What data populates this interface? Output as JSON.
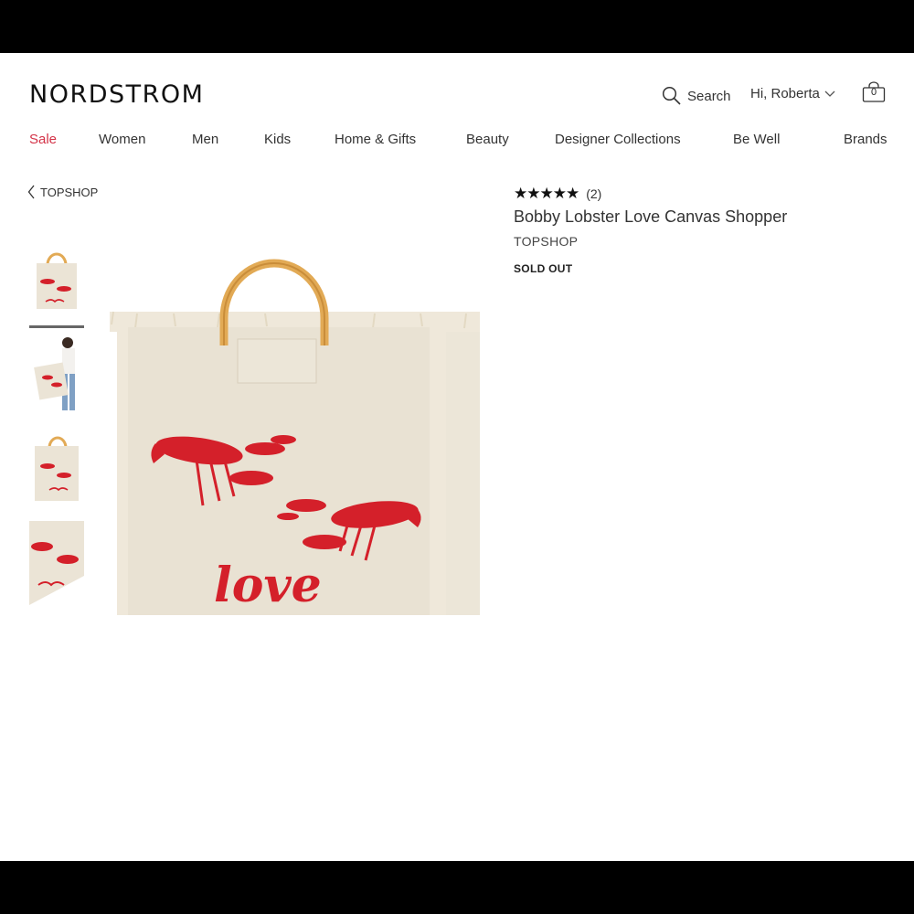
{
  "brand": {
    "logo_text": "NORDSTROM"
  },
  "header": {
    "search_label": "Search",
    "user_label": "Hi, Roberta",
    "bag_count": "0"
  },
  "nav": {
    "items": [
      "Sale",
      "Women",
      "Men",
      "Kids",
      "Home & Gifts",
      "Beauty",
      "Designer Collections",
      "Be Well",
      "Brands"
    ]
  },
  "breadcrumb": {
    "label": "TOPSHOP"
  },
  "product": {
    "stars": "★★★★★",
    "rating_count": "(2)",
    "name": "Bobby Lobster Love Canvas Shopper",
    "brand": "TOPSHOP",
    "status": "SOLD OUT",
    "image_text": "love",
    "rating_value": 5
  },
  "colors": {
    "sale": "#d33247",
    "canvas": "#e9e2d3",
    "lobster": "#d4202a",
    "handle": "#e2aa55"
  }
}
